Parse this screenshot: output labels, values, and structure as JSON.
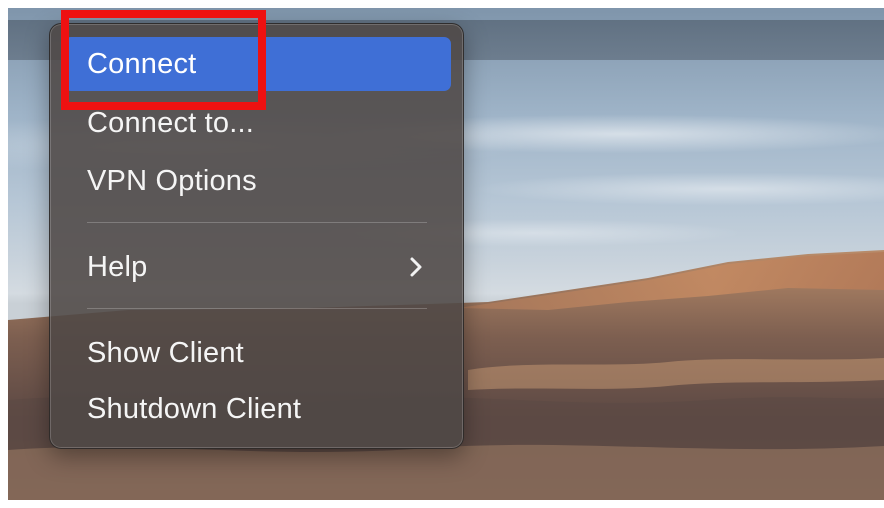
{
  "menu": {
    "items": [
      {
        "label": "Connect",
        "selected": true
      },
      {
        "label": "Connect to..."
      },
      {
        "label": "VPN Options"
      },
      {
        "label": "Help",
        "has_submenu": true
      },
      {
        "label": "Show Client"
      },
      {
        "label": "Shutdown Client"
      }
    ]
  },
  "icons": {
    "submenu": "chevron-right-icon"
  },
  "colors": {
    "selected_background": "#3f6fd6",
    "menu_background": "#4e4846",
    "highlight_box": "#ee1111"
  }
}
